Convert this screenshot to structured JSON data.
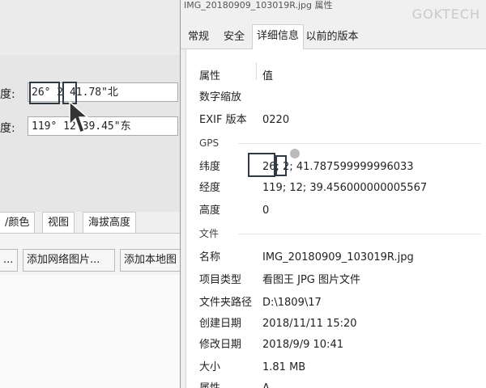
{
  "left_app": {
    "title": "",
    "latitude": {
      "label": "度:",
      "value": "26° 2 41.78\"北"
    },
    "longitude": {
      "label": "度:",
      "value": "119° 12 39.45\"东"
    },
    "tabs": [
      "/颜色",
      "视图",
      "海拔高度"
    ],
    "buttons": [
      "...",
      "添加网络图片...",
      "添加本地图"
    ]
  },
  "dialog": {
    "title": "IMG_20180909_103019R.jpg 属性",
    "watermark": "GOKTECH",
    "tabs": [
      "常规",
      "安全",
      "详细信息",
      "以前的版本"
    ],
    "active_tab": "详细信息",
    "columns": {
      "property": "属性",
      "value": "值"
    },
    "rows_top": [
      {
        "key": "数字缩放",
        "value": ""
      },
      {
        "key": "EXIF 版本",
        "value": "0220"
      }
    ],
    "gps_group": "GPS",
    "gps_rows": [
      {
        "key": "纬度",
        "value": "26; 2; 41.787599999996033"
      },
      {
        "key": "经度",
        "value": "119; 12; 39.456000000005567"
      },
      {
        "key": "高度",
        "value": "0"
      }
    ],
    "file_group": "文件",
    "file_rows": [
      {
        "key": "名称",
        "value": "IMG_20180909_103019R.jpg"
      },
      {
        "key": "项目类型",
        "value": "看图王 JPG 图片文件"
      },
      {
        "key": "文件夹路径",
        "value": "D:\\1809\\17"
      },
      {
        "key": "创建日期",
        "value": "2018/11/11 15:20"
      },
      {
        "key": "修改日期",
        "value": "2018/9/9 10:41"
      },
      {
        "key": "大小",
        "value": "1.81 MB"
      },
      {
        "key": "属性",
        "value": "A"
      }
    ]
  }
}
